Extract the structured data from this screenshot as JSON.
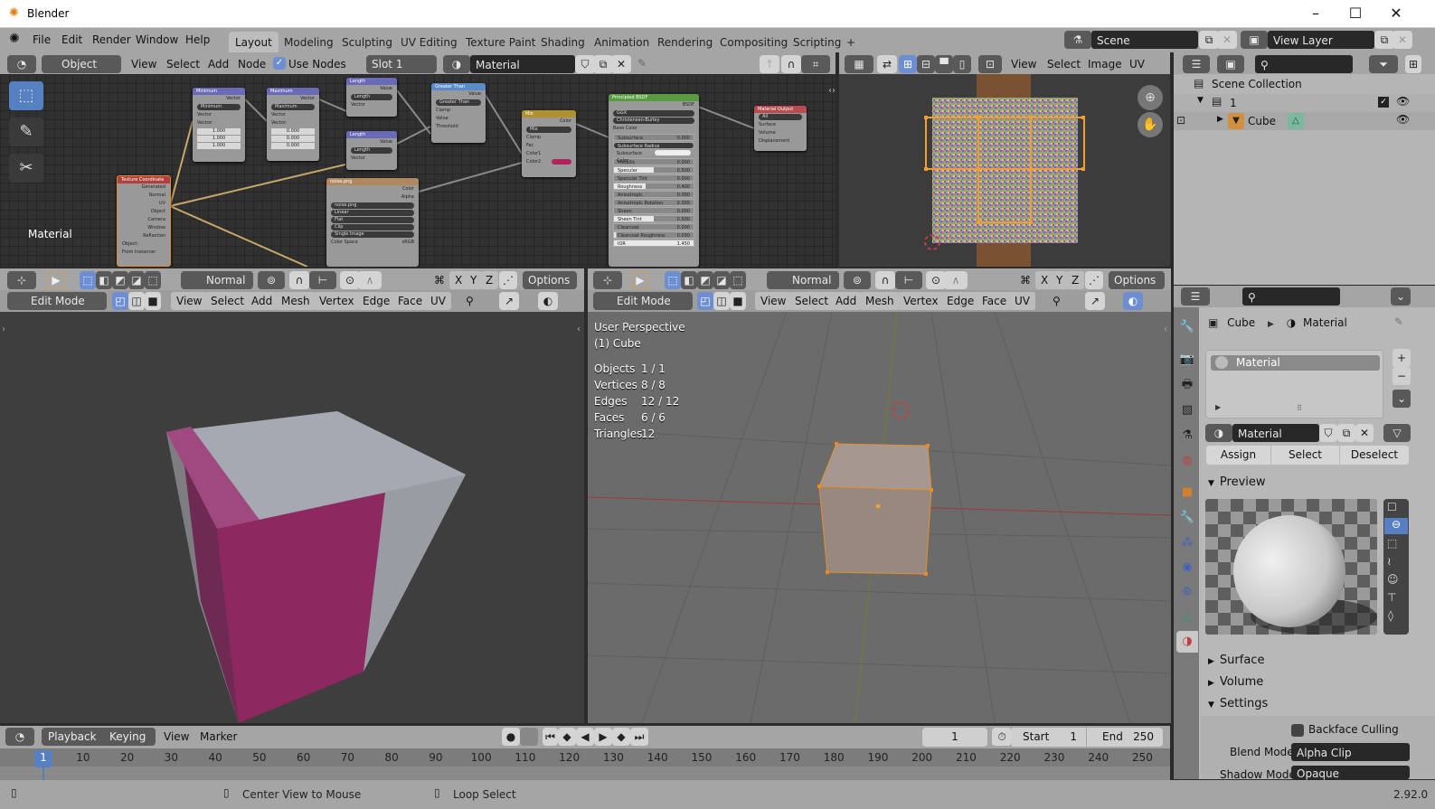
{
  "window": {
    "title": "Blender",
    "controls": [
      "minimize",
      "maximize",
      "close"
    ]
  },
  "topbar": {
    "menus": [
      "File",
      "Edit",
      "Render",
      "Window",
      "Help"
    ],
    "workspaces": [
      "Layout",
      "Modeling",
      "Sculpting",
      "UV Editing",
      "Texture Paint",
      "Shading",
      "Animation",
      "Rendering",
      "Compositing",
      "Scripting"
    ],
    "active_workspace": "Layout",
    "add_workspace": "+",
    "scene": "Scene",
    "view_layer": "View Layer"
  },
  "node_editor": {
    "object_mode": "Object",
    "menus": [
      "View",
      "Select",
      "Add",
      "Node"
    ],
    "use_nodes_label": "Use Nodes",
    "use_nodes_checked": true,
    "slot": "Slot 1",
    "material": "Material",
    "overlay_label": "Material",
    "nodes": {
      "texture_coordinate": {
        "title": "Texture Coordinate",
        "outputs": [
          "Generated",
          "Normal",
          "UV",
          "Object",
          "Camera",
          "Window",
          "Reflection"
        ],
        "object_label": "Object:",
        "from_instancer": "From Instancer"
      },
      "minimum": {
        "title": "Minimum",
        "output": "Vector",
        "mode": "Minimum",
        "input": "Vector",
        "vector_label": "Vector:",
        "values": [
          "1.000",
          "1.000",
          "1.000"
        ]
      },
      "maximum": {
        "title": "Maximum",
        "output": "Vector",
        "mode": "Maximum",
        "input": "Vector",
        "vector_label": "Vector:",
        "values": [
          "0.000",
          "0.000",
          "0.000"
        ]
      },
      "length1": {
        "title": "Length",
        "output": "Value",
        "mode": "Length",
        "input": "Vector"
      },
      "length2": {
        "title": "Length",
        "output": "Value",
        "mode": "Length",
        "input": "Vector"
      },
      "greater_than": {
        "title": "Greater Than",
        "output": "Value",
        "mode": "Greater Than",
        "clamp": "Clamp",
        "inputs": [
          "Value",
          "Threshold"
        ]
      },
      "image": {
        "title": "noise.png",
        "outputs": [
          "Color",
          "Alpha"
        ],
        "file": "noise.png",
        "interpolation": "Linear",
        "projection": "Flat",
        "extension": "Clip",
        "source": "Single Image",
        "color_space_label": "Color Space",
        "color_space": "sRGB"
      },
      "mix": {
        "title": "Mix",
        "output": "Color",
        "mode": "Mix",
        "clamp": "Clamp",
        "inputs": [
          "Fac",
          "Color1",
          "Color2"
        ],
        "color2": "#b0245e"
      },
      "principled": {
        "title": "Principled BSDF",
        "output": "BSDF",
        "distribution": "GGX",
        "subsurface_method": "Christensen-Burley",
        "base_color": "Base Color",
        "params": [
          {
            "name": "Subsurface",
            "value": "0.000",
            "fill": 0
          },
          {
            "name": "Subsurface Radius",
            "value": "",
            "fill": 0
          },
          {
            "name": "Subsurface Color",
            "value": "",
            "fill": 0
          },
          {
            "name": "Metallic",
            "value": "0.000",
            "fill": 0
          },
          {
            "name": "Specular",
            "value": "0.500",
            "fill": 0.5
          },
          {
            "name": "Specular Tint",
            "value": "0.000",
            "fill": 0
          },
          {
            "name": "Roughness",
            "value": "0.400",
            "fill": 0.4
          },
          {
            "name": "Anisotropic",
            "value": "0.000",
            "fill": 0
          },
          {
            "name": "Anisotropic Rotation",
            "value": "0.000",
            "fill": 0
          },
          {
            "name": "Sheen",
            "value": "0.000",
            "fill": 0
          },
          {
            "name": "Sheen Tint",
            "value": "0.500",
            "fill": 0.5
          },
          {
            "name": "Clearcoat",
            "value": "0.000",
            "fill": 0
          },
          {
            "name": "Clearcoat Roughness",
            "value": "0.030",
            "fill": 0.03
          },
          {
            "name": "IOR",
            "value": "1.450",
            "fill": 1
          }
        ]
      },
      "output": {
        "title": "Material Output",
        "target": "All",
        "inputs": [
          "Surface",
          "Volume",
          "Displacement"
        ]
      }
    }
  },
  "uv_editor": {
    "menus": [
      "View",
      "Select",
      "Image",
      "UV"
    ]
  },
  "outliner": {
    "scene_collection": "Scene Collection",
    "collection": "1",
    "object": "Cube"
  },
  "viewport_left": {
    "orientation": "Normal",
    "mode": "Edit Mode",
    "menus": [
      "View",
      "Select",
      "Add",
      "Mesh",
      "Vertex",
      "Edge",
      "Face",
      "UV"
    ],
    "axes": [
      "X",
      "Y",
      "Z"
    ],
    "options": "Options"
  },
  "viewport_right": {
    "orientation": "Normal",
    "mode": "Edit Mode",
    "menus": [
      "View",
      "Select",
      "Add",
      "Mesh",
      "Vertex",
      "Edge",
      "Face",
      "UV"
    ],
    "axes": [
      "X",
      "Y",
      "Z"
    ],
    "options": "Options",
    "view_name": "User Perspective",
    "object_name": "(1) Cube",
    "stats": [
      {
        "label": "Objects",
        "value": "1 / 1"
      },
      {
        "label": "Vertices",
        "value": "8 / 8"
      },
      {
        "label": "Edges",
        "value": "12 / 12"
      },
      {
        "label": "Faces",
        "value": "6 / 6"
      },
      {
        "label": "Triangles",
        "value": "12"
      }
    ]
  },
  "properties": {
    "breadcrumb_object": "Cube",
    "breadcrumb_material": "Material",
    "slot_item": "Material",
    "material_name": "Material",
    "assign": "Assign",
    "select": "Select",
    "deselect": "Deselect",
    "sections": {
      "preview": "Preview",
      "surface": "Surface",
      "volume": "Volume",
      "settings": "Settings"
    },
    "backface_culling": "Backface Culling",
    "blend_mode_label": "Blend Mode",
    "blend_mode": "Alpha Clip",
    "shadow_mode_label": "Shadow Mode",
    "shadow_mode": "Opaque"
  },
  "timeline": {
    "menus": [
      "Playback",
      "Keying",
      "View",
      "Marker"
    ],
    "current_frame": "1",
    "start_label": "Start",
    "start": "1",
    "end_label": "End",
    "end": "250",
    "ticks": [
      "1",
      "10",
      "20",
      "30",
      "40",
      "50",
      "60",
      "70",
      "80",
      "90",
      "100",
      "110",
      "120",
      "130",
      "140",
      "150",
      "160",
      "170",
      "180",
      "190",
      "200",
      "210",
      "220",
      "230",
      "240",
      "250"
    ]
  },
  "statusbar": {
    "hint_middle": "Center View to Mouse",
    "hint_right": "Loop Select",
    "version": "2.92.0"
  },
  "colors": {
    "accent": "#5680c2",
    "selection": "#f0a030",
    "magenta": "#8e2860"
  }
}
